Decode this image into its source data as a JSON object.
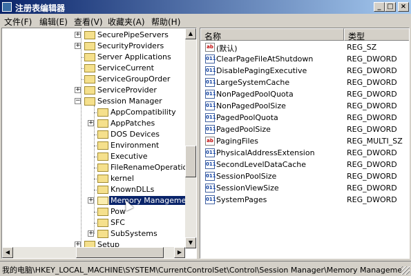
{
  "window": {
    "title": "注册表编辑器",
    "buttons": {
      "minimize": "_",
      "maximize": "□",
      "close": "×"
    }
  },
  "menu": [
    "文件(F)",
    "编辑(E)",
    "查看(V)",
    "收藏夹(A)",
    "帮助(H)"
  ],
  "tree": {
    "items": [
      {
        "label": "SecurePipeServers",
        "expander": "+",
        "level": 0
      },
      {
        "label": "SecurityProviders",
        "expander": "+",
        "level": 0
      },
      {
        "label": "Server Applications",
        "expander": "",
        "level": 0
      },
      {
        "label": "ServiceCurrent",
        "expander": "",
        "level": 0
      },
      {
        "label": "ServiceGroupOrder",
        "expander": "",
        "level": 0
      },
      {
        "label": "ServiceProvider",
        "expander": "+",
        "level": 0
      },
      {
        "label": "Session Manager",
        "expander": "−",
        "level": 0
      },
      {
        "label": "AppCompatibility",
        "expander": "",
        "level": 1
      },
      {
        "label": "AppPatches",
        "expander": "+",
        "level": 1
      },
      {
        "label": "DOS Devices",
        "expander": "",
        "level": 1
      },
      {
        "label": "Environment",
        "expander": "",
        "level": 1
      },
      {
        "label": "Executive",
        "expander": "",
        "level": 1
      },
      {
        "label": "FileRenameOperations",
        "expander": "",
        "level": 1
      },
      {
        "label": "kernel",
        "expander": "",
        "level": 1
      },
      {
        "label": "KnownDLLs",
        "expander": "",
        "level": 1
      },
      {
        "label": "Memory Management",
        "expander": "+",
        "level": 1,
        "selected": true
      },
      {
        "label": "Pow",
        "expander": "",
        "level": 1
      },
      {
        "label": "SFC",
        "expander": "",
        "level": 1
      },
      {
        "label": "SubSystems",
        "expander": "+",
        "level": 1
      },
      {
        "label": "Setup",
        "expander": "+",
        "level": 0
      }
    ]
  },
  "list": {
    "columns": {
      "name": "名称",
      "type": "类型"
    },
    "rows": [
      {
        "icon": "ab",
        "name": "(默认)",
        "type": "REG_SZ"
      },
      {
        "icon": "011",
        "name": "ClearPageFileAtShutdown",
        "type": "REG_DWORD"
      },
      {
        "icon": "011",
        "name": "DisablePagingExecutive",
        "type": "REG_DWORD"
      },
      {
        "icon": "011",
        "name": "LargeSystemCache",
        "type": "REG_DWORD"
      },
      {
        "icon": "011",
        "name": "NonPagedPoolQuota",
        "type": "REG_DWORD"
      },
      {
        "icon": "011",
        "name": "NonPagedPoolSize",
        "type": "REG_DWORD"
      },
      {
        "icon": "011",
        "name": "PagedPoolQuota",
        "type": "REG_DWORD"
      },
      {
        "icon": "011",
        "name": "PagedPoolSize",
        "type": "REG_DWORD"
      },
      {
        "icon": "ab",
        "name": "PagingFiles",
        "type": "REG_MULTI_SZ"
      },
      {
        "icon": "011",
        "name": "PhysicalAddressExtension",
        "type": "REG_DWORD"
      },
      {
        "icon": "011",
        "name": "SecondLevelDataCache",
        "type": "REG_DWORD"
      },
      {
        "icon": "011",
        "name": "SessionPoolSize",
        "type": "REG_DWORD"
      },
      {
        "icon": "011",
        "name": "SessionViewSize",
        "type": "REG_DWORD"
      },
      {
        "icon": "011",
        "name": "SystemPages",
        "type": "REG_DWORD"
      }
    ]
  },
  "scroll_arrows": {
    "up": "▲",
    "down": "▼",
    "left": "◀",
    "right": "▶"
  },
  "statusbar": {
    "path": "我的电脑\\HKEY_LOCAL_MACHINE\\SYSTEM\\CurrentControlSet\\Control\\Session Manager\\Memory Management"
  },
  "colors": {
    "title_start": "#0a246a",
    "title_end": "#a6caf0",
    "selection": "#0a246a",
    "face": "#d4d0c8"
  }
}
